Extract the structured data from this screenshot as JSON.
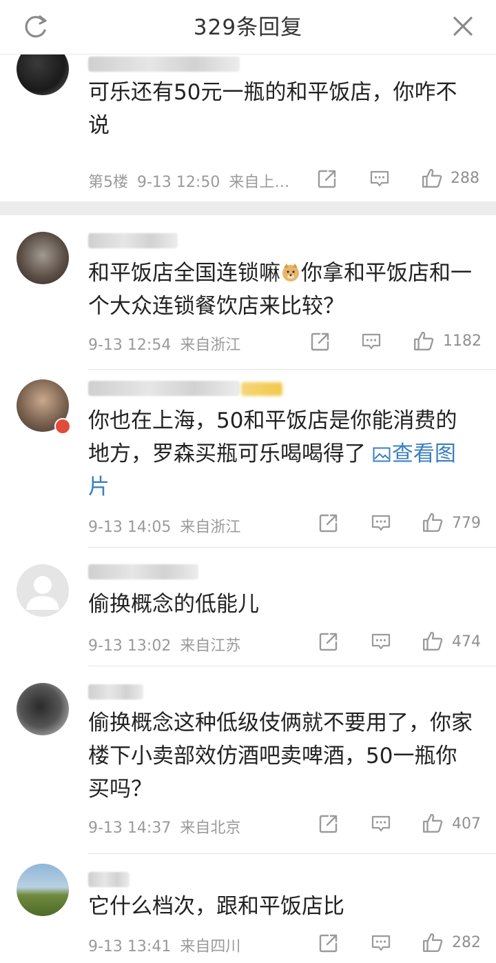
{
  "header": {
    "title": "329条回复",
    "refresh_icon": "refresh-icon",
    "close_icon": "close-icon"
  },
  "comments": [
    {
      "text": "可乐还有50元一瓶的和平饭店，你咋不说",
      "floor": "第5楼",
      "time": "9-13 12:50",
      "source": "来自上…",
      "likes": "288"
    },
    {
      "text_before": "和平饭店全国连锁嘛",
      "text_after": "你拿和平饭店和一个大众连锁餐饮店来比较？",
      "time": "9-13 12:54",
      "source": "来自浙江",
      "likes": "1182"
    },
    {
      "text": "你也在上海，50和平饭店是你能消费的地方，罗森买瓶可乐喝喝得了",
      "link": "查看图片",
      "time": "9-13 14:05",
      "source": "来自浙江",
      "likes": "779"
    },
    {
      "text": "偷换概念的低能儿",
      "time": "9-13 13:02",
      "source": "来自江苏",
      "likes": "474"
    },
    {
      "text": "偷换概念这种低级伎俩就不要用了，你家楼下小卖部效仿酒吧卖啤酒，50一瓶你买吗？",
      "time": "9-13 14:37",
      "source": "来自北京",
      "likes": "407"
    },
    {
      "text": "它什么档次，跟和平饭店比",
      "time": "9-13 13:41",
      "source": "来自四川",
      "likes": "282"
    }
  ],
  "colors": {
    "link": "#3a7fc1",
    "meta": "#9a9a9a",
    "divider": "#e4e4e4",
    "badge": "#e24b3b"
  }
}
